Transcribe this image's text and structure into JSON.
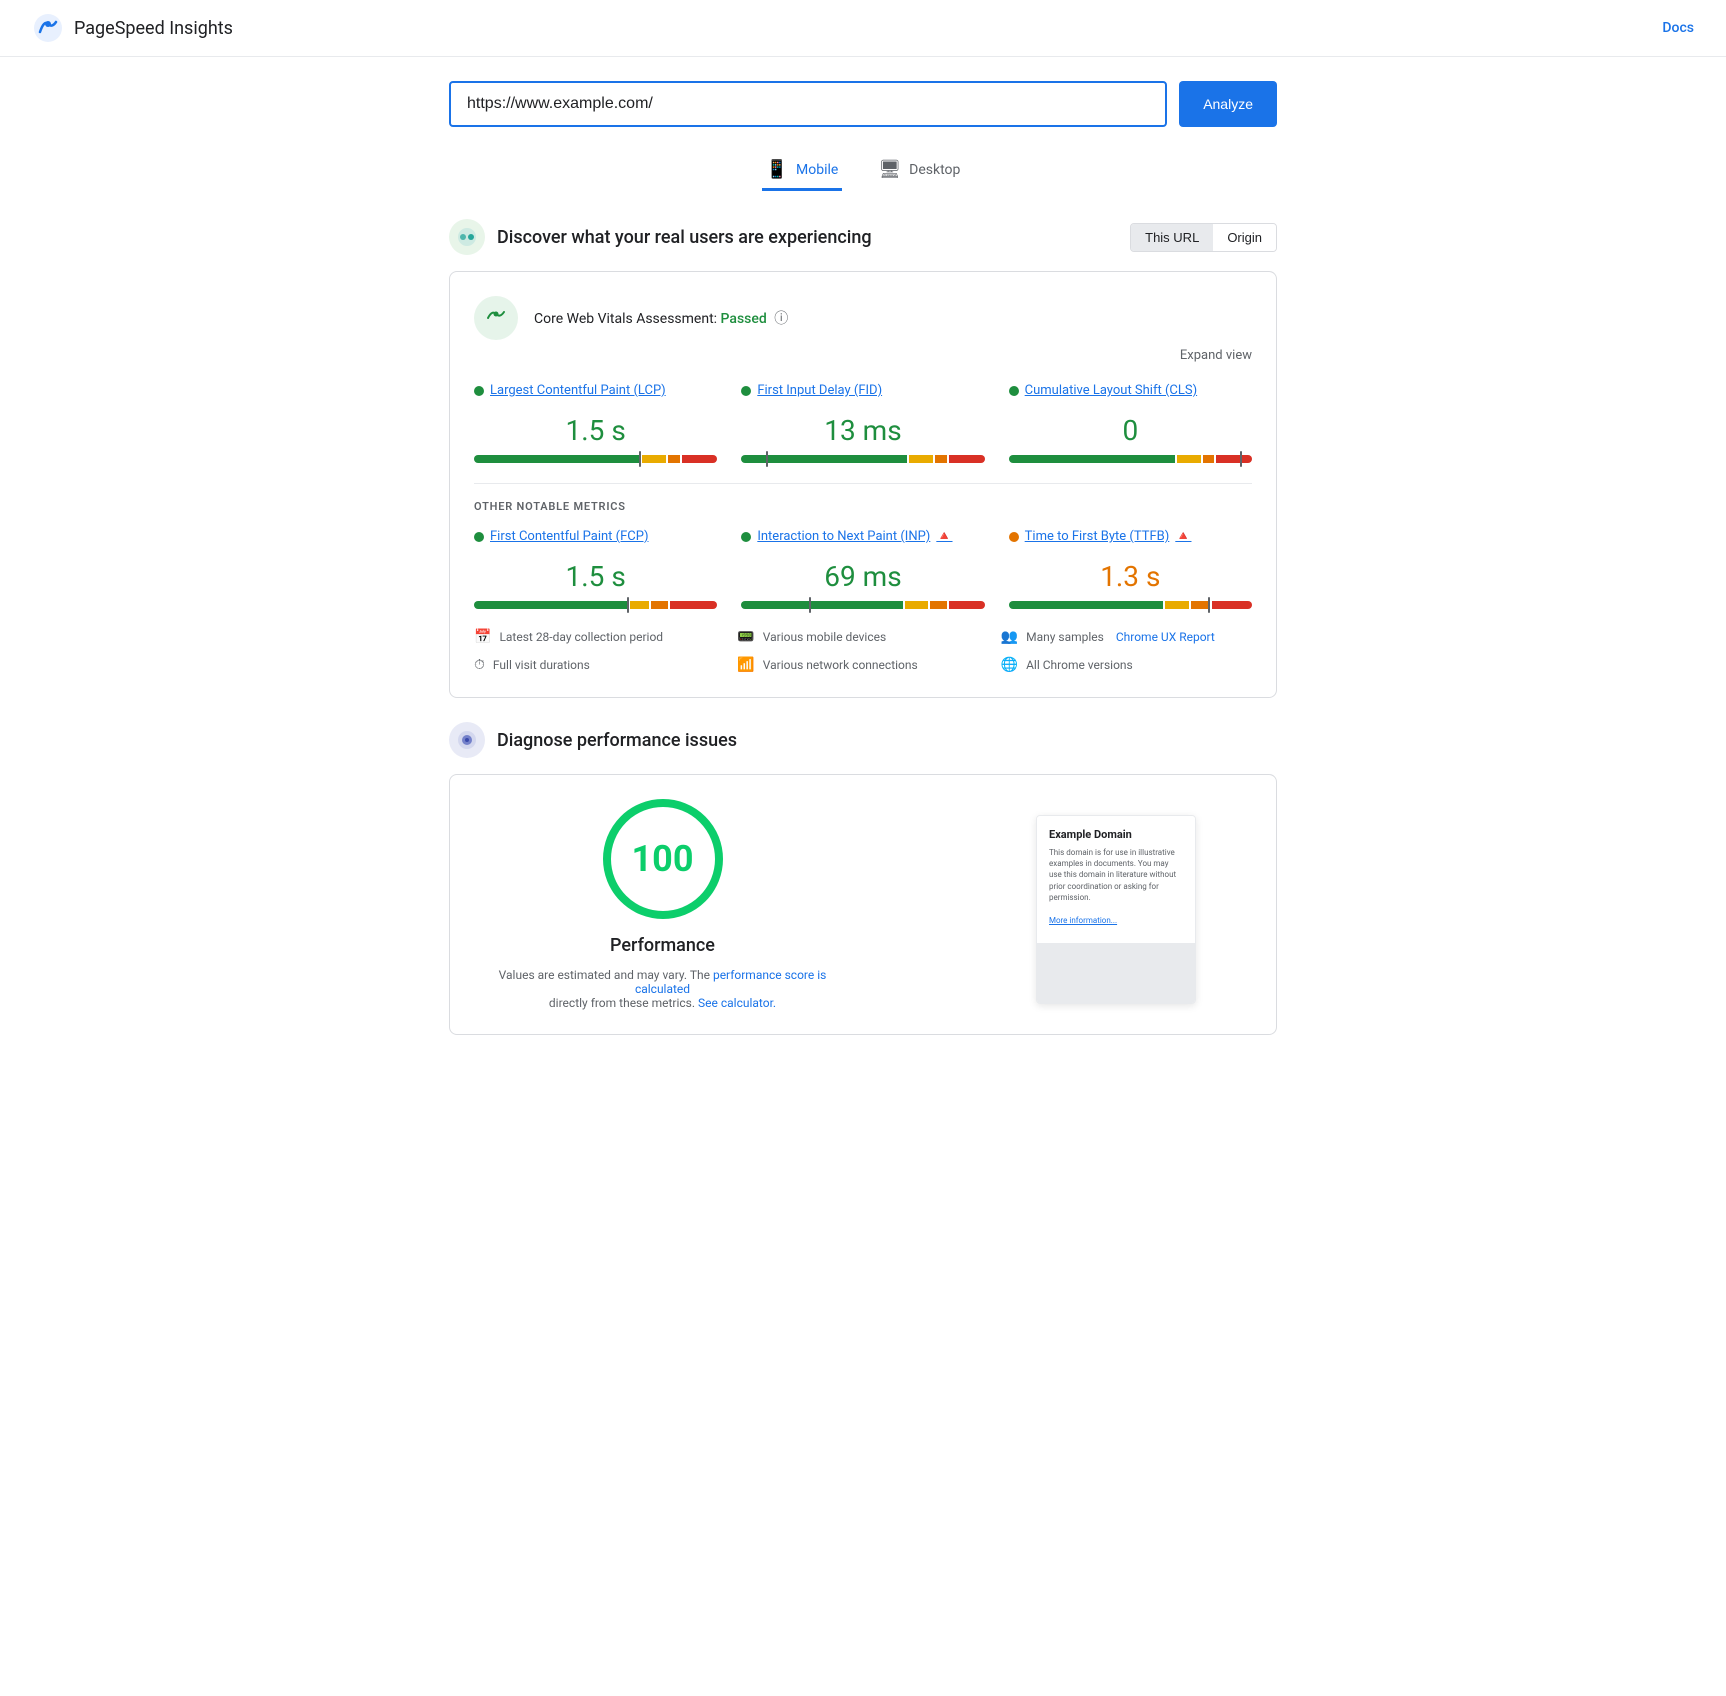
{
  "header": {
    "logo_text": "PageSpeed Insights",
    "docs_label": "Docs"
  },
  "search": {
    "url_value": "https://www.example.com/",
    "analyze_label": "Analyze"
  },
  "tabs": [
    {
      "label": "Mobile",
      "active": true,
      "icon": "📱"
    },
    {
      "label": "Desktop",
      "active": false,
      "icon": "🖥"
    }
  ],
  "crux_section": {
    "title": "Discover what your real users are experiencing",
    "this_url_label": "This URL",
    "origin_label": "Origin",
    "cwv_title": "Core Web Vitals Assessment:",
    "cwv_status": "Passed",
    "expand_view_label": "Expand view",
    "metrics": [
      {
        "label": "Largest Contentful Paint (LCP)",
        "value": "1.5 s",
        "color": "green",
        "dot": "green",
        "bar_green": 70,
        "bar_yellow": 10,
        "bar_orange": 5,
        "bar_red": 15,
        "marker_pct": 68
      },
      {
        "label": "First Input Delay (FID)",
        "value": "13 ms",
        "color": "green",
        "dot": "green",
        "bar_green": 70,
        "bar_yellow": 10,
        "bar_orange": 5,
        "bar_red": 15,
        "marker_pct": 10
      },
      {
        "label": "Cumulative Layout Shift (CLS)",
        "value": "0",
        "color": "green",
        "dot": "green",
        "bar_green": 70,
        "bar_yellow": 10,
        "bar_orange": 5,
        "bar_red": 15,
        "marker_pct": 95
      }
    ],
    "notable_label": "OTHER NOTABLE METRICS",
    "notable_metrics": [
      {
        "label": "First Contentful Paint (FCP)",
        "value": "1.5 s",
        "color": "green",
        "dot": "green",
        "has_info": false,
        "bar_green": 65,
        "bar_yellow": 8,
        "bar_orange": 7,
        "bar_red": 20,
        "marker_pct": 63
      },
      {
        "label": "Interaction to Next Paint (INP)",
        "value": "69 ms",
        "color": "green",
        "dot": "green",
        "has_info": true,
        "bar_green": 68,
        "bar_yellow": 10,
        "bar_orange": 7,
        "bar_red": 15,
        "marker_pct": 28
      },
      {
        "label": "Time to First Byte (TTFB)",
        "value": "1.3 s",
        "color": "orange",
        "dot": "orange",
        "has_info": true,
        "bar_green": 65,
        "bar_yellow": 10,
        "bar_orange": 8,
        "bar_red": 17,
        "marker_pct": 82
      }
    ],
    "info_items": [
      {
        "icon": "📅",
        "text": "Latest 28-day collection period"
      },
      {
        "icon": "📟",
        "text": "Various mobile devices"
      },
      {
        "icon": "👥",
        "text": "Many samples"
      },
      {
        "icon": "⏱",
        "text": "Full visit durations"
      },
      {
        "icon": "📶",
        "text": "Various network connections"
      },
      {
        "icon": "🌐",
        "text": "All Chrome versions"
      }
    ],
    "chrome_ux_label": "Chrome UX Report"
  },
  "diagnose_section": {
    "title": "Diagnose performance issues",
    "score": "100",
    "perf_label": "Performance",
    "perf_note_text": "Values are estimated and may vary. The",
    "perf_link_text": "performance score is calculated",
    "perf_note_mid": "directly from these metrics.",
    "see_calc_label": "See calculator.",
    "preview": {
      "title": "Example Domain",
      "text": "This domain is for use in illustrative examples in documents. You may use this domain in literature without prior coordination or asking for permission.",
      "link": "More information..."
    }
  }
}
